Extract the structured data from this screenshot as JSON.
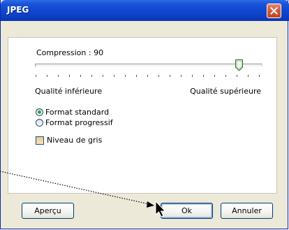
{
  "window": {
    "title": "JPEG"
  },
  "compression": {
    "label": "Compression : 90",
    "value": 90,
    "min_label": "Qualité inférieure",
    "max_label": "Qualité supérieure"
  },
  "format": {
    "options": [
      {
        "label": "Format standard",
        "selected": true
      },
      {
        "label": "Format progressif",
        "selected": false
      }
    ]
  },
  "grayscale": {
    "label": "Niveau de gris",
    "checked": false
  },
  "buttons": {
    "preview": "Aperçu",
    "ok": "Ok",
    "cancel": "Annuler"
  },
  "icons": {
    "close": "close-icon",
    "cursor": "mouse-pointer-icon"
  },
  "colors": {
    "titlebar": "#0c3fc6",
    "close": "#d55a3a",
    "radio_dot": "#2ea82e",
    "annotation_line": "#000000"
  }
}
